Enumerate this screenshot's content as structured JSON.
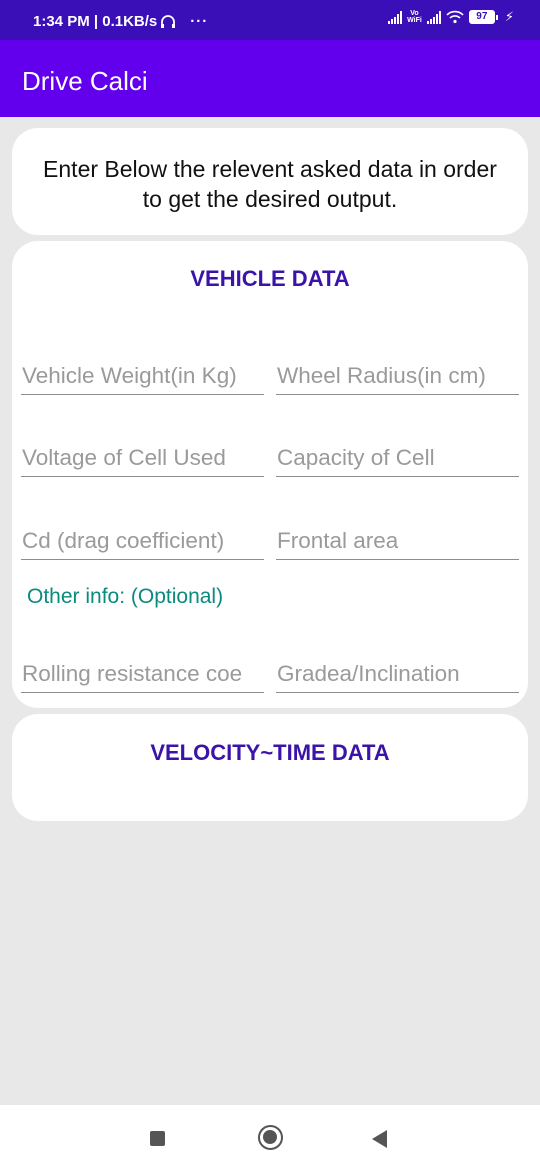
{
  "status_bar": {
    "time_speed": "1:34 PM | 0.1KB/s",
    "overflow": "···",
    "vowifi_top": "Vo",
    "vowifi_bottom": "WiFi",
    "battery": "97",
    "icons": [
      "headset-icon",
      "signal-icon",
      "vowifi-icon",
      "signal-icon",
      "wifi-icon",
      "battery-icon",
      "charging-icon"
    ]
  },
  "app_bar": {
    "title": "Drive Calci"
  },
  "intro": {
    "text": "Enter Below the relevent asked data in order to get the desired output."
  },
  "vehicle": {
    "title": "VEHICLE DATA",
    "fields": {
      "vehicle_weight": "Vehicle Weight(in Kg)",
      "wheel_radius": "Wheel Radius(in cm)",
      "cell_voltage": "Voltage of Cell Used",
      "cell_capacity": "Capacity of Cell",
      "drag_coefficient": "Cd (drag coefficient)",
      "frontal_area": "Frontal area",
      "rolling_resistance": "Rolling resistance coe",
      "gradient": "Gradea/Inclination"
    },
    "optional_label": "Other info: (Optional)"
  },
  "velocity": {
    "title": "VELOCITY~TIME DATA"
  },
  "colors": {
    "status_bar": "#3b0fb8",
    "app_bar": "#6200ee",
    "section_title": "#3c13a8",
    "optional_text": "#0b8a7e",
    "background": "#e8e8e8"
  }
}
